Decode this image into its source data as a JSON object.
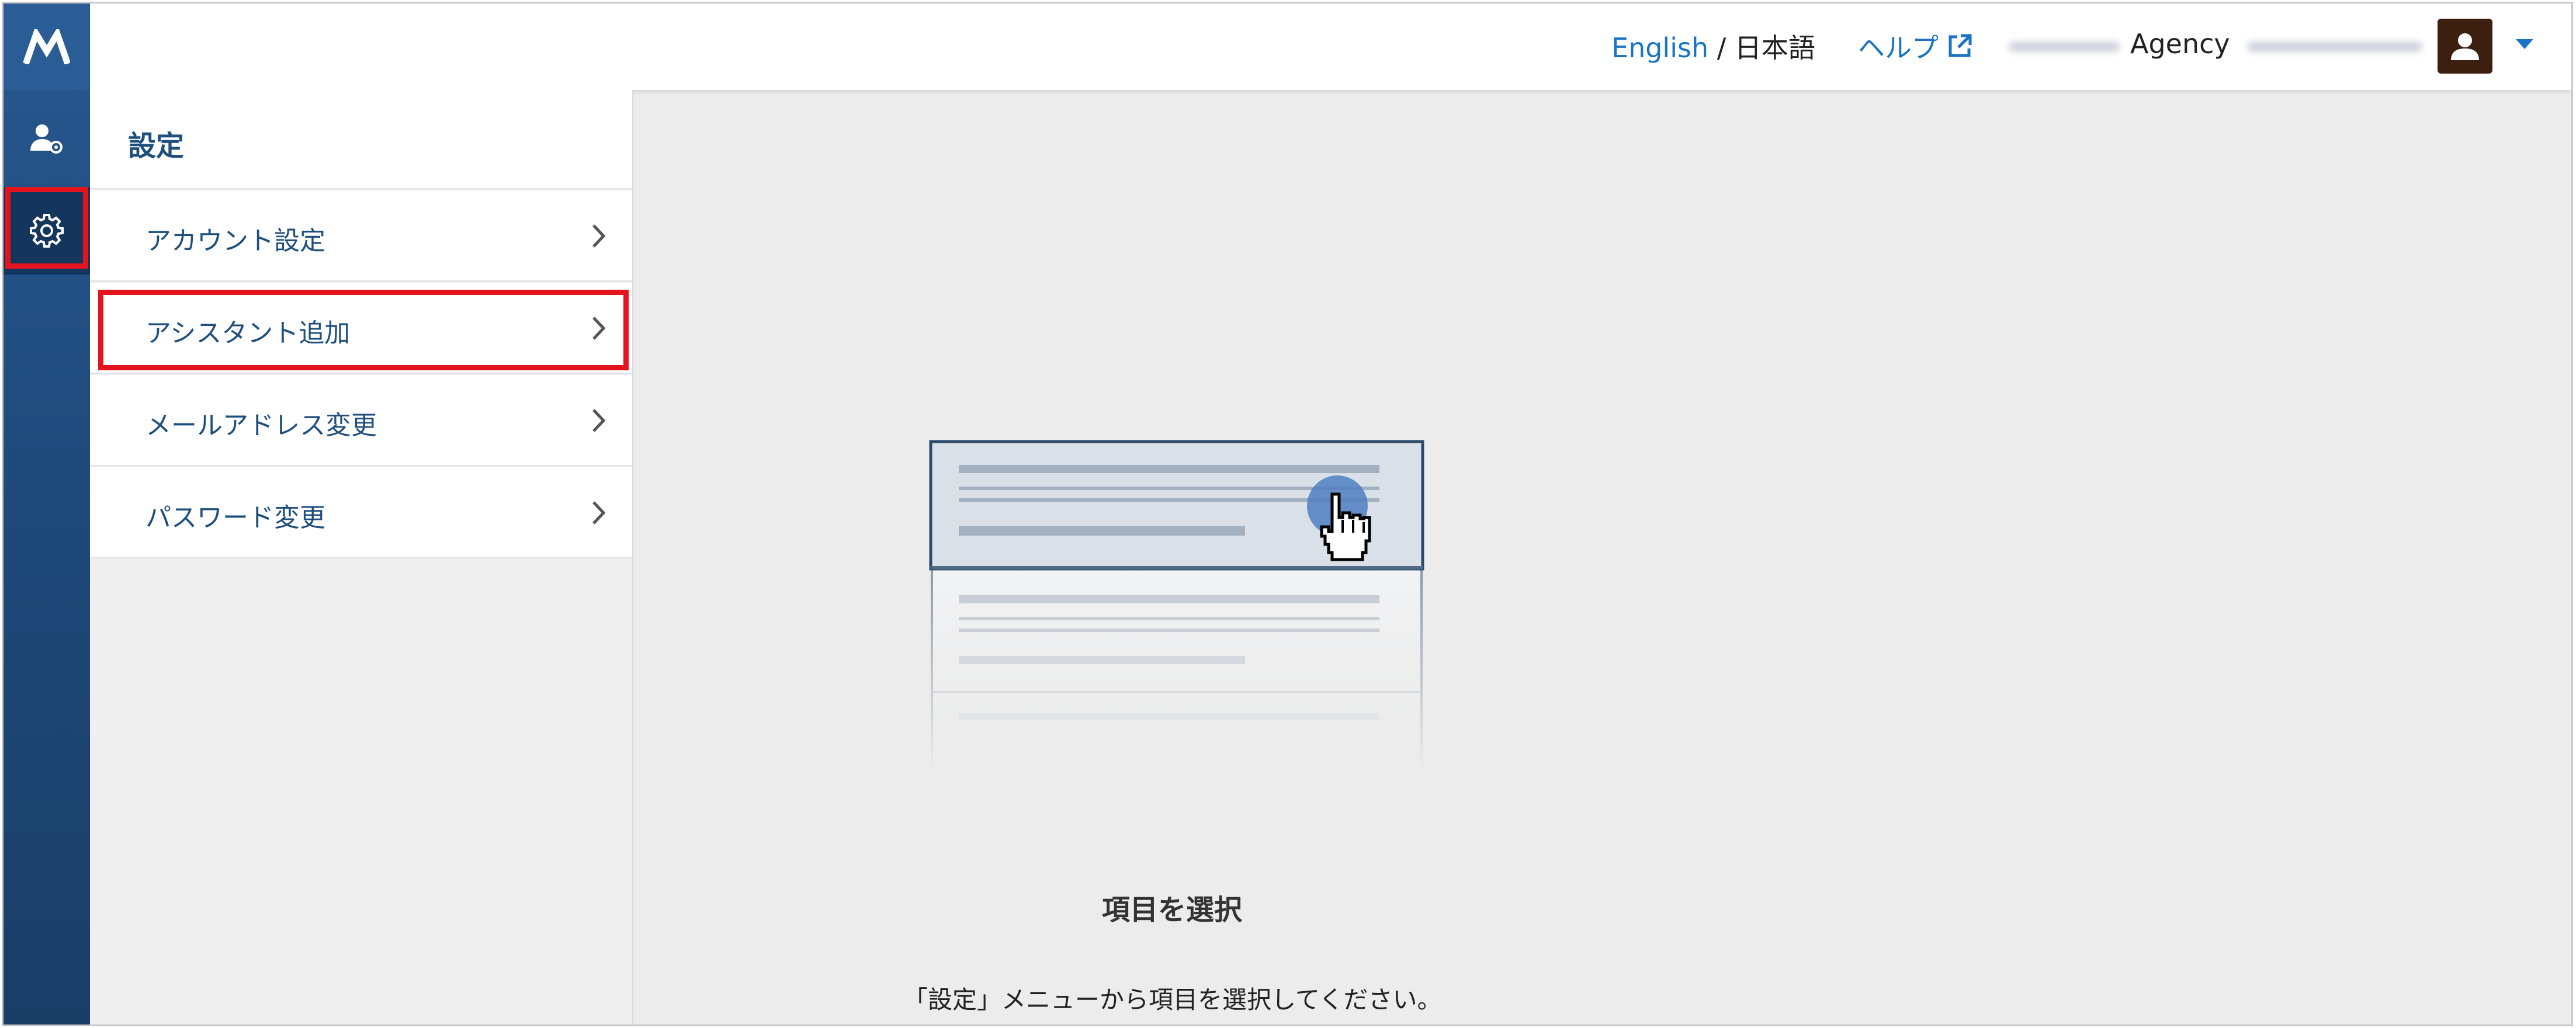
{
  "header": {
    "lang_english": "English",
    "lang_sep": " / ",
    "lang_japanese": "日本語",
    "help": "ヘルプ",
    "agency": "Agency"
  },
  "sidebar_panel": {
    "title": "設定",
    "items": [
      {
        "label": "アカウント設定"
      },
      {
        "label": "アシスタント追加"
      },
      {
        "label": "メールアドレス変更"
      },
      {
        "label": "パスワード変更"
      }
    ]
  },
  "main": {
    "empty_title": "項目を選択",
    "empty_desc": "「設定」メニューから項目を選択してください。"
  },
  "colors": {
    "accent_link": "#1a73c4",
    "rail_bg": "#1f4a7c",
    "highlight": "#e4141e",
    "menu_text": "#1e4f7d"
  },
  "icons": {
    "logo": "logo-icon",
    "users": "user-settings-icon",
    "settings": "gear-icon",
    "external": "external-link-icon",
    "avatar": "avatar-icon",
    "caret": "caret-down-icon",
    "chevron": "chevron-right-icon"
  }
}
